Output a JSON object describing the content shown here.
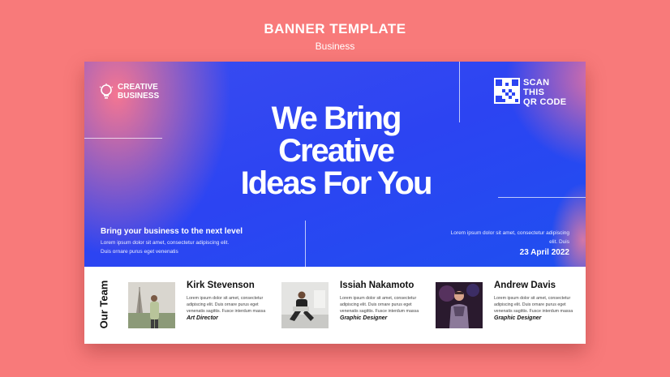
{
  "header": {
    "title": "BANNER TEMPLATE",
    "subtitle": "Business"
  },
  "hero": {
    "logo_line1": "CREATIVE",
    "logo_line2": "BUSINESS",
    "scan_line1": "SCAN",
    "scan_line2": "THIS",
    "scan_line3": "QR CODE",
    "headline_line1": "We Bring",
    "headline_line2": "Creative",
    "headline_line3": "Ideas For You",
    "tagline": "Bring your business to the next level",
    "tag_body": "Lorem ipsum dolor sit amet, consectetur adipiscing elit. Duis ornare purus eget venenatis",
    "right_body": "Lorem ipsum dolor sit amet, consectetur adipiscing elit. Duis",
    "date": "23 April 2022"
  },
  "team": {
    "label": "Our Team",
    "members": [
      {
        "name": "Kirk Stevenson",
        "desc": "Lorem ipsum dolor sit amet, consectetur adipiscing elit. Duis ornare purus eget venenatis sagittis. Fusce interdum massa",
        "role": "Art Director"
      },
      {
        "name": "Issiah Nakamoto",
        "desc": "Lorem ipsum dolor sit amet, consectetur adipiscing elit. Duis ornare purus eget venenatis sagittis. Fusce interdum massa",
        "role": "Graphic Designer"
      },
      {
        "name": "Andrew Davis",
        "desc": "Lorem ipsum dolor sit amet, consectetur adipiscing elit. Duis ornare purus eget venenatis sagittis. Fusce interdum massa",
        "role": "Graphic Designer"
      }
    ]
  },
  "colors": {
    "background": "#f87a7a",
    "hero_blue": "#2c44f2",
    "accent_pink": "#ff7890"
  }
}
